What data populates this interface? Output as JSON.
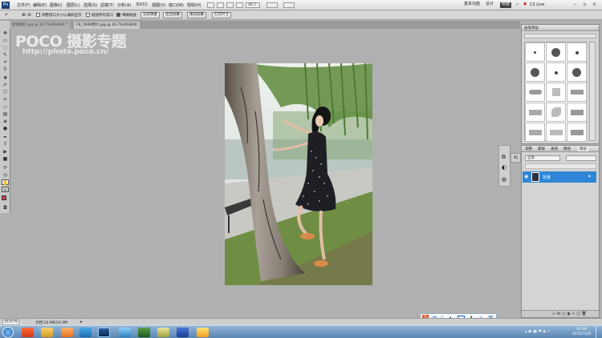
{
  "app": {
    "logo": "Ps",
    "menu": [
      "文件(F)",
      "编辑(E)",
      "图像(I)",
      "图层(L)",
      "选择(S)",
      "滤镜(T)",
      "分析(A)",
      "3D(D)",
      "视图(V)",
      "窗口(W)",
      "帮助(H)"
    ],
    "zoom_value": "16.7",
    "workspaces": [
      "基本功能",
      "设计",
      "绘画"
    ],
    "active_workspace": "绘画",
    "cs_live": "CS Live"
  },
  "options": {
    "resize_label": "调整窗口大小以满屏显示",
    "all_windows_label": "缩放所有窗口",
    "scrubby_label": "细微缩放",
    "actual_pixels": "实际像素",
    "fit_screen": "适合屏幕",
    "fill_screen": "填充屏幕",
    "print_size": "打印尺寸"
  },
  "tabs": [
    {
      "label": "原始图片.jpg @ 16.7%(RGB/8) *",
      "active": false
    },
    {
      "label": "FB_7846原片.jpg @ 16.7%(RGB/8)",
      "active": true
    }
  ],
  "watermark": {
    "brand": "POCO 摄影专题",
    "url": "http://photo.poco.cn/"
  },
  "brush_panel": {
    "title": "画笔预设"
  },
  "layers_panel": {
    "tabs": [
      "调整",
      "蒙版",
      "通道",
      "路径",
      "图层"
    ],
    "active_tab": "图层",
    "blend_mode": "正常",
    "layer_name": "背景"
  },
  "status": {
    "zoom": "16.67%",
    "doc_size": "文档:24.9M/24.9M"
  },
  "taskbar": {
    "time": "16:48",
    "date": "2012/7/26"
  },
  "ime": {
    "icons": [
      "sogou-icon",
      "中",
      "moon-icon",
      "dot-icon",
      "keyboard-icon",
      "user-icon",
      "shirt-icon",
      "wrench-icon"
    ]
  },
  "colors": {
    "ui_gray": "#b0b0b0",
    "selection_blue": "#2f86d8",
    "foreground": "#c8405a",
    "background": "#ffffff"
  }
}
